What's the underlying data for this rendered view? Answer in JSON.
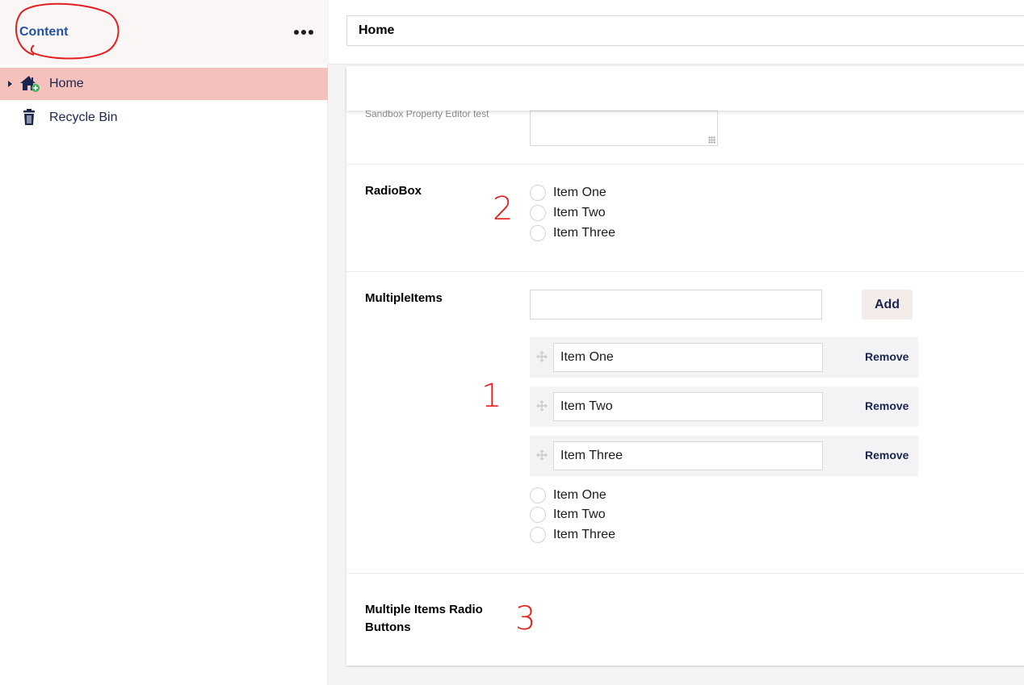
{
  "sidebar": {
    "title": "Content",
    "more_icon": "ellipsis-icon",
    "items": [
      {
        "label": "Home",
        "icon": "home-icon",
        "active": true
      },
      {
        "label": "Recycle Bin",
        "icon": "trash-icon",
        "active": false
      }
    ]
  },
  "editor": {
    "name_value": "Home",
    "description": "Sandbox Property Editor test",
    "properties": {
      "radiobox": {
        "label": "RadioBox",
        "options": [
          "Item One",
          "Item Two",
          "Item Three"
        ]
      },
      "multiple_items": {
        "label": "MultipleItems",
        "add_label": "Add",
        "remove_label": "Remove",
        "items": [
          "Item One",
          "Item Two",
          "Item Three"
        ],
        "radio_options": [
          "Item One",
          "Item Two",
          "Item Three"
        ]
      },
      "multiple_items_radio": {
        "label_line1": "Multiple Items Radio",
        "label_line2": "Buttons"
      }
    }
  },
  "annotations": [
    "2",
    "1",
    "3"
  ],
  "colors": {
    "accent": "#2152a3",
    "active_item": "#f5c1bc",
    "annotation": "#e41d1d",
    "navy": "#1b264f"
  }
}
